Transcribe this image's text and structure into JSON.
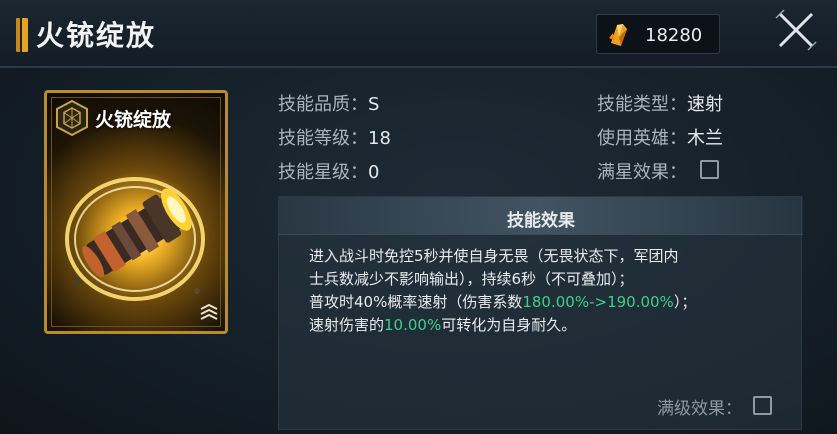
{
  "header": {
    "title": "火铳绽放",
    "currency_icon": "crystal-shard-icon",
    "currency_amount": "18280",
    "close_icon": "close-x-icon"
  },
  "card": {
    "title": "火铳绽放",
    "emblem_icon": "hexagon-emblem-icon",
    "art": "glowing-cannon-barrel",
    "rank_icon": "rank-chevron-icon"
  },
  "stats": {
    "quality_label": "技能品质：",
    "quality_value": "S",
    "level_label": "技能等级：",
    "level_value": "18",
    "star_label": "技能星级：",
    "star_value": "0",
    "type_label": "技能类型：",
    "type_value": "速射",
    "hero_label": "使用英雄：",
    "hero_value": "木兰",
    "fullstar_label": "满星效果：",
    "fullstar_checked": false
  },
  "effect": {
    "title": "技能效果",
    "line1": "进入战斗时免控5秒并使自身无畏（无畏状态下，军团内",
    "line2": "士兵数减少不影响输出），持续6秒（不可叠加）；",
    "line3_a": "普攻时40%概率速射（伤害系数",
    "line3_hl": "180.00%->190.00%",
    "line3_b": "）；",
    "line4_a": "速射伤害的",
    "line4_hl": "10.00%",
    "line4_b": "可转化为自身耐久。",
    "maxlevel_label": "满级效果：",
    "maxlevel_checked": false
  },
  "colors": {
    "highlight": "#3fcf8a",
    "card_border": "#b88b2e",
    "background": "#152029"
  }
}
